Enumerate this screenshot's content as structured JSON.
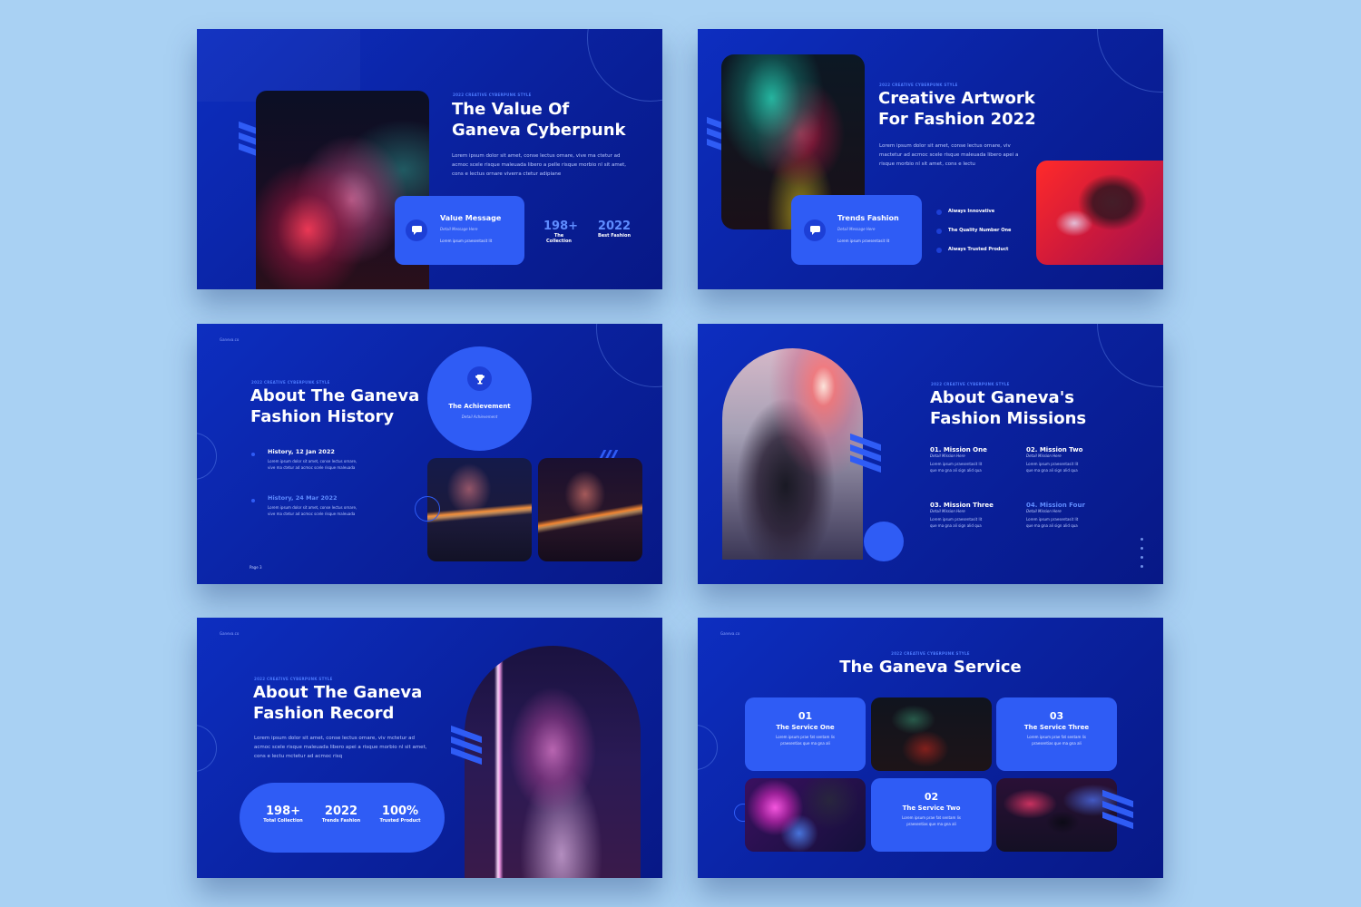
{
  "slide1": {
    "eyebrow": "2022 CREATIVE CYBERPUNK STYLE",
    "title_line1": "The Value Of",
    "title_line2": "Ganeva Cyberpunk",
    "body": "Lorem ipsum dolor sit amet, conse lectus ornare, vive ma ctetur ad acmoc scele risque maleuada libero a pelle risque morbio nl sit amet, cons e lectus ornare viverra ctetur adipiane",
    "card_title": "Value Message",
    "card_sub": "Detail Message Here",
    "card_text": "Lorem ipsum praesentasit lit",
    "stats": [
      {
        "num": "198+",
        "label": "The Collection"
      },
      {
        "num": "2022",
        "label": "Best Fashion"
      }
    ]
  },
  "slide2": {
    "eyebrow": "2022 CREATIVE CYBERPUNK STYLE",
    "title_line1": "Creative Artwork",
    "title_line2": "For Fashion 2022",
    "body": "Lorem ipsum dolor sit amet, conse lectus ornare, viv mactetur ad acmoc scele risque maleuada libero apei a risque morbio nl sit amet, cons e lectu",
    "card_title": "Trends Fashion",
    "card_sub": "Detail Message Here",
    "card_text": "Lorem ipsum praesentasit lit",
    "list": [
      "Always Innovative",
      "The Quality Number One",
      "Always Trusted Product"
    ]
  },
  "slide3": {
    "logo": "Ganeva.co",
    "eyebrow": "2022 CREATIVE CYBERPUNK STYLE",
    "title_line1": "About The Ganeva",
    "title_line2": "Fashion History",
    "achievement_title": "The Achievement",
    "achievement_sub": "Detail Achievement",
    "history": [
      {
        "date": "History, 12 Jan 2022",
        "text1": "Lorem ipsum dolor sit amet, conse lectus ornare,",
        "text2": "vive ma ctetur ad acmoc scele risque maleuada"
      },
      {
        "date": "History, 24 Mar 2022",
        "text1": "Lorem ipsum dolor sit amet, conse lectus ornare,",
        "text2": "vive ma ctetur ad acmoc scele risque maleuada"
      }
    ],
    "footer": "Page 3"
  },
  "slide4": {
    "eyebrow": "2022 CREATIVE CYBERPUNK STYLE",
    "title_line1": "About Ganeva's",
    "title_line2": "Fashion Missions",
    "missions": [
      {
        "title": "01. Mission One",
        "sub": "Detail Mission Here",
        "text1": "Lorem ipsum praesentasit lit",
        "text2": "que ma gna ali sign alid qua"
      },
      {
        "title": "02. Mission Two",
        "sub": "Detail Mission Here",
        "text1": "Lorem ipsum praesentasit lit",
        "text2": "que ma gna ali sign alid qua"
      },
      {
        "title": "03. Mission Three",
        "sub": "Detail Mission Here",
        "text1": "Lorem ipsum praesentasit lit",
        "text2": "que ma gna ali sign alid qua"
      },
      {
        "title": "04. Mission Four",
        "sub": "Detail Mission Here",
        "text1": "Lorem ipsum praesentasit lit",
        "text2": "que ma gna ali sign alid qua"
      }
    ]
  },
  "slide5": {
    "logo": "Ganeva.co",
    "eyebrow": "2022 CREATIVE CYBERPUNK STYLE",
    "title_line1": "About The Ganeva",
    "title_line2": "Fashion Record",
    "body": "Lorem ipsum dolor sit amet, conse lectus ornare, viv mctetur ad acmoc scele risque maleuada libero apei a risque morbio nl sit amet, cons e lectu mctetur ad acmoc risq",
    "stats": [
      {
        "num": "198+",
        "label": "Total Collection"
      },
      {
        "num": "2022",
        "label": "Trends Fashion"
      },
      {
        "num": "100%",
        "label": "Trusted Product"
      }
    ]
  },
  "slide6": {
    "logo": "Ganeva.co",
    "eyebrow": "2022 CREATIVE CYBERPUNK STYLE",
    "title": "The Ganeva Service",
    "services": [
      {
        "num": "01",
        "title": "The Service One",
        "text1": "Lorem ipsum prae fat sentam lis",
        "text2": "praesentias que ma gna ali"
      },
      {
        "num": "03",
        "title": "The Service Three",
        "text1": "Lorem ipsum prae fat sentam lis",
        "text2": "praesentias que ma gna ali"
      },
      {
        "num": "02",
        "title": "The Service Two",
        "text1": "Lorem ipsum prae fat sentam lis",
        "text2": "praesentias que ma gna ali"
      }
    ]
  },
  "colors": {
    "page_bg": "#a9d1f3",
    "slide_bg": "#0a22a0",
    "accent": "#2f5cf5",
    "accent_text": "#5f8cff"
  },
  "icons": {
    "message": "chat-bubble-icon",
    "trophy": "trophy-icon",
    "stripes": "diagonal-stripes-icon"
  }
}
